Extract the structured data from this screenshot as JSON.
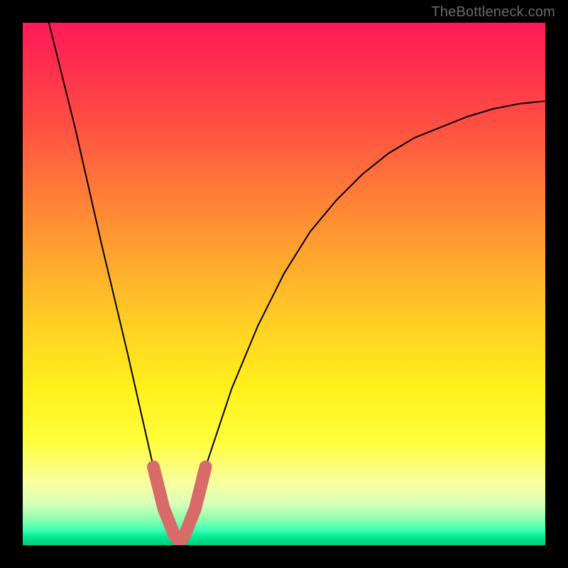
{
  "watermark": "TheBottleneck.com",
  "chart_data": {
    "type": "line",
    "title": "",
    "xlabel": "",
    "ylabel": "",
    "xlim": [
      0,
      100
    ],
    "ylim": [
      0,
      100
    ],
    "grid": false,
    "legend": false,
    "background_gradient": {
      "direction": "top-to-bottom",
      "stops": [
        {
          "pct": 0,
          "color": "#ff1a57"
        },
        {
          "pct": 20,
          "color": "#ff5142"
        },
        {
          "pct": 45,
          "color": "#ffa62e"
        },
        {
          "pct": 70,
          "color": "#fff01c"
        },
        {
          "pct": 88,
          "color": "#f8ffa0"
        },
        {
          "pct": 95,
          "color": "#8dffad"
        },
        {
          "pct": 100,
          "color": "#00c97a"
        }
      ]
    },
    "series": [
      {
        "name": "bottleneck-curve",
        "color": "#000000",
        "stroke_width": 2,
        "x": [
          5,
          10,
          15,
          20,
          25,
          27,
          29,
          30,
          31,
          33,
          35,
          40,
          45,
          50,
          55,
          60,
          65,
          70,
          75,
          80,
          85,
          90,
          95,
          100
        ],
        "y": [
          100,
          80,
          58,
          37,
          15,
          7,
          2,
          0,
          2,
          7,
          15,
          30,
          42,
          52,
          60,
          66,
          71,
          75,
          78,
          80,
          82,
          83.5,
          84.5,
          85
        ]
      },
      {
        "name": "highlight-band",
        "color": "#d86a6a",
        "stroke_width": 10,
        "x": [
          25,
          27,
          29,
          30,
          31,
          33,
          35
        ],
        "y": [
          15,
          7,
          2,
          0,
          2,
          7,
          15
        ]
      }
    ],
    "minimum_x": 30
  }
}
